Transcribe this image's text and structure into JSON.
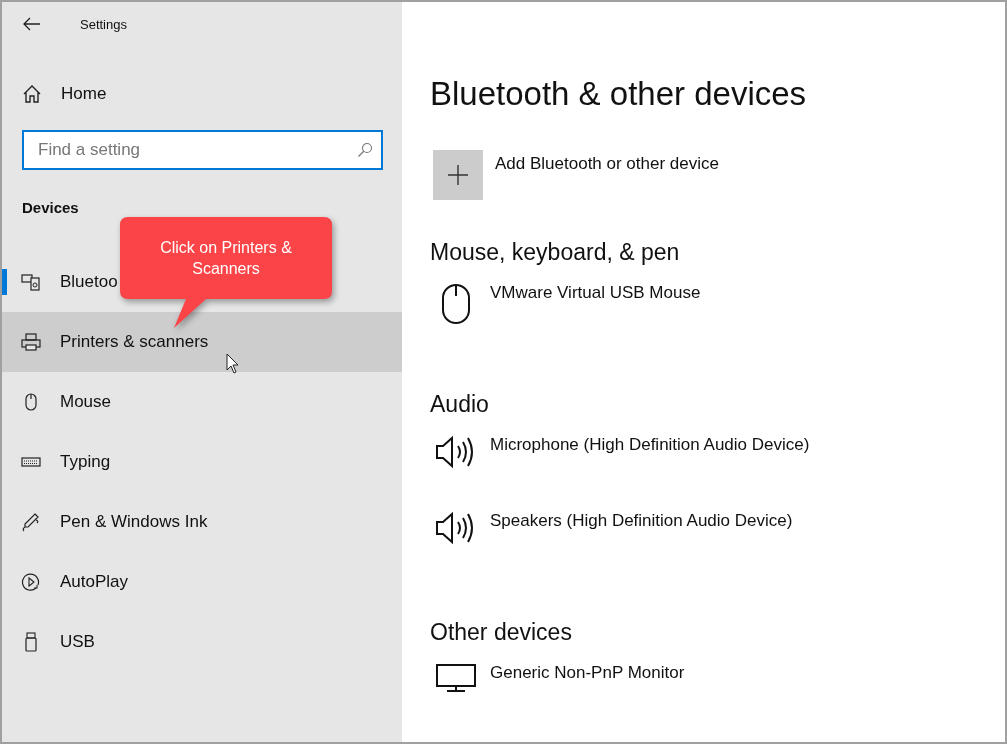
{
  "window": {
    "title": "Settings"
  },
  "sidebar": {
    "home": "Home",
    "search": {
      "placeholder": "Find a setting"
    },
    "section": "Devices",
    "items": [
      {
        "label": "Bluetoo",
        "kind": "bluetooth",
        "selected": true,
        "hovered": false
      },
      {
        "label": "Printers & scanners",
        "kind": "printer",
        "selected": false,
        "hovered": true
      },
      {
        "label": "Mouse",
        "kind": "mouse",
        "selected": false,
        "hovered": false
      },
      {
        "label": "Typing",
        "kind": "keyboard",
        "selected": false,
        "hovered": false
      },
      {
        "label": "Pen & Windows Ink",
        "kind": "pen",
        "selected": false,
        "hovered": false
      },
      {
        "label": "AutoPlay",
        "kind": "autoplay",
        "selected": false,
        "hovered": false
      },
      {
        "label": "USB",
        "kind": "usb",
        "selected": false,
        "hovered": false
      }
    ]
  },
  "callout": {
    "text": "Click on Printers & Scanners"
  },
  "main": {
    "title": "Bluetooth & other devices",
    "add_button": "Add Bluetooth or other device",
    "sections": [
      {
        "title": "Mouse, keyboard, & pen",
        "devices": [
          {
            "name": "VMware Virtual USB Mouse",
            "kind": "mouse"
          }
        ]
      },
      {
        "title": "Audio",
        "devices": [
          {
            "name": "Microphone (High Definition Audio Device)",
            "kind": "speaker"
          },
          {
            "name": "Speakers (High Definition Audio Device)",
            "kind": "speaker"
          }
        ]
      },
      {
        "title": "Other devices",
        "devices": [
          {
            "name": "Generic Non-PnP Monitor",
            "kind": "monitor"
          }
        ]
      }
    ]
  }
}
